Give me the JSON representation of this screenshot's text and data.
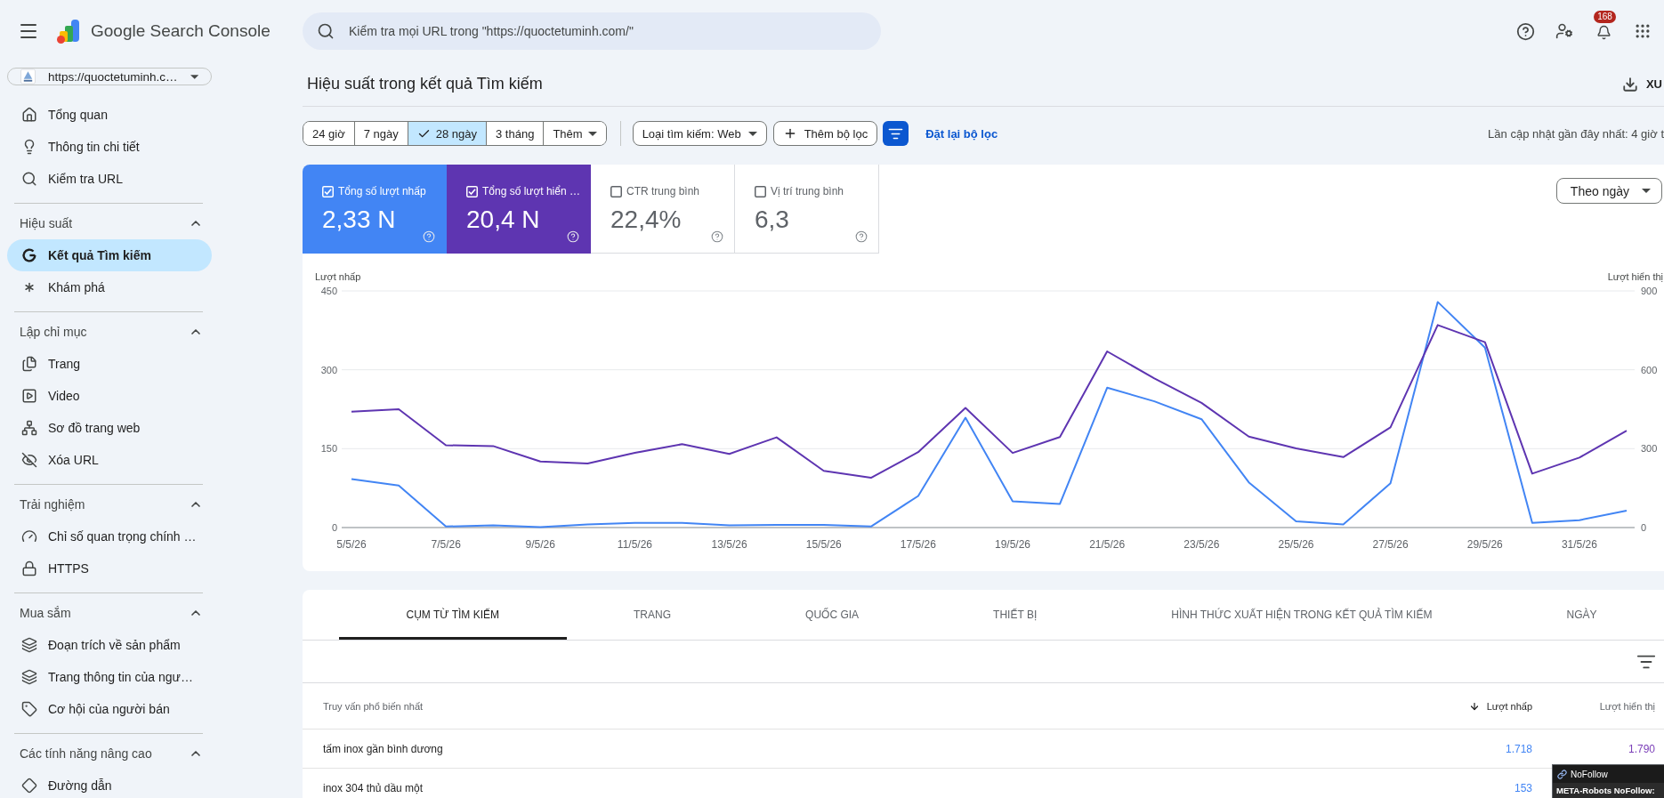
{
  "header": {
    "logo_text": "Google Search Console",
    "search": {
      "placeholder": "Kiểm tra mọi URL trong \"https://quoctetuminh.com/\""
    },
    "notification_count": "168"
  },
  "sidebar": {
    "property": "https://quoctetuminh.c…",
    "top_items": [
      {
        "label": "Tổng quan",
        "selected": false
      },
      {
        "label": "Thông tin chi tiết",
        "selected": false
      },
      {
        "label": "Kiểm tra URL",
        "selected": false
      }
    ],
    "sections": [
      {
        "title": "Hiệu suất",
        "expanded": true,
        "items": [
          {
            "label": "Kết quả Tìm kiếm",
            "selected": true
          },
          {
            "label": "Khám phá",
            "selected": false
          }
        ]
      },
      {
        "title": "Lập chỉ mục",
        "expanded": true,
        "items": [
          {
            "label": "Trang",
            "selected": false
          },
          {
            "label": "Video",
            "selected": false
          },
          {
            "label": "Sơ đồ trang web",
            "selected": false
          },
          {
            "label": "Xóa URL",
            "selected": false
          }
        ]
      },
      {
        "title": "Trải nghiệm",
        "expanded": true,
        "items": [
          {
            "label": "Chỉ số quan trọng chính …",
            "selected": false
          },
          {
            "label": "HTTPS",
            "selected": false
          }
        ]
      },
      {
        "title": "Mua sắm",
        "expanded": true,
        "items": [
          {
            "label": "Đoạn trích về sản phẩm",
            "selected": false
          },
          {
            "label": "Trang thông tin của ngư…",
            "selected": false
          },
          {
            "label": "Cơ hội của người bán",
            "selected": false
          }
        ]
      },
      {
        "title": "Các tính năng nâng cao",
        "expanded": true,
        "items": [
          {
            "label": "Đường dẫn",
            "selected": false
          }
        ]
      }
    ]
  },
  "main": {
    "title": "Hiệu suất trong kết quả Tìm kiếm",
    "export_label": "XU",
    "date_ranges": [
      {
        "label": "24 giờ",
        "selected": false,
        "kind": "option"
      },
      {
        "label": "7 ngày",
        "selected": false,
        "kind": "option"
      },
      {
        "label": "28 ngày",
        "selected": true,
        "kind": "option"
      },
      {
        "label": "3 tháng",
        "selected": false,
        "kind": "option"
      },
      {
        "label": "Thêm",
        "selected": false,
        "kind": "menu"
      }
    ],
    "search_type": "Loại tìm kiếm: Web",
    "add_filter": "Thêm bộ lọc",
    "reset_filters": "Đặt lại bộ lọc",
    "last_updated": "Lần cập nhật gần đây nhất: 4 giờ t",
    "metrics": [
      {
        "label": "Tổng số lượt nhấp",
        "value": "2,33 N",
        "checked": true,
        "color": "#4285f4"
      },
      {
        "label": "Tổng số lượt hiển …",
        "value": "20,4 N",
        "checked": true,
        "color": "#5e35b1"
      },
      {
        "label": "CTR trung bình",
        "value": "22,4%",
        "checked": false
      },
      {
        "label": "Vị trí trung bình",
        "value": "6,3",
        "checked": false
      }
    ],
    "granularity": "Theo ngày",
    "chart_layers": [
      {
        "kind": "primary",
        "chart_data": {
          "type": "line",
          "ylabel": "Lượt nhấp",
          "categories": [
            "5/5/26",
            null,
            "7/5/26",
            null,
            "9/5/26",
            null,
            "11/5/26",
            null,
            "13/5/26",
            null,
            "15/5/26",
            null,
            "17/5/26",
            null,
            "19/5/26",
            null,
            "21/5/26",
            null,
            "23/5/26",
            null,
            "25/5/26",
            null,
            "27/5/26",
            null,
            "29/5/26",
            null,
            "31/5/26",
            null
          ],
          "ylim": [
            0,
            450
          ],
          "yticks": [
            0,
            150,
            300,
            450
          ],
          "series": [
            {
              "color": "#4285f4",
              "values": [
                92,
                80,
                2,
                4,
                1,
                6,
                9,
                9,
                4,
                5,
                5,
                2,
                60,
                209,
                50,
                45,
                266,
                240,
                206,
                86,
                12,
                6,
                84,
                429,
                342,
                9,
                14,
                32
              ]
            }
          ]
        }
      },
      {
        "kind": "secondary",
        "chart_data": {
          "type": "line",
          "ylabel": "Lượt hiển thị",
          "categories": [
            null,
            null,
            null,
            null,
            null,
            null,
            null,
            null,
            null,
            null,
            null,
            null,
            null,
            null,
            null,
            null,
            null,
            null,
            null,
            null,
            null,
            null,
            null,
            null,
            null,
            null,
            null,
            null
          ],
          "ylim": [
            0,
            900
          ],
          "yticks": [
            0,
            300,
            600,
            900
          ],
          "series": [
            {
              "color": "#5e35b1",
              "values": [
                441,
                450,
                313,
                310,
                251,
                244,
                284,
                317,
                280,
                343,
                216,
                189,
                287,
                455,
                284,
                344,
                670,
                567,
                474,
                346,
                301,
                268,
                381,
                770,
                705,
                205,
                266,
                368
              ]
            }
          ]
        }
      }
    ]
  },
  "table": {
    "tabs": [
      {
        "label": "CỤM TỪ TÌM KIẾM",
        "selected": true
      },
      {
        "label": "TRANG",
        "selected": false
      },
      {
        "label": "QUỐC GIA",
        "selected": false
      },
      {
        "label": "THIẾT BỊ",
        "selected": false
      },
      {
        "label": "HÌNH THỨC XUẤT HIỆN TRONG KẾT QUẢ TÌM KIẾM",
        "selected": false
      },
      {
        "label": "NGÀY",
        "selected": false
      }
    ],
    "columns": [
      {
        "label": "Truy vấn phổ biến nhất",
        "sorted": false
      },
      {
        "label": "Lượt nhấp",
        "sorted": true,
        "color": "#4285f4"
      },
      {
        "label": "Lượt hiển thị",
        "sorted": false,
        "color": "#7b3fb8"
      }
    ],
    "rows": [
      {
        "query": "tấm inox gần bình dương",
        "clicks": "1.718",
        "impressions": "1.790"
      },
      {
        "query": "inox 304 thủ dầu một",
        "clicks": "153"
      }
    ]
  },
  "extension_popup": {
    "title": "NoFollow",
    "text": "META-Robots NoFollow:"
  }
}
